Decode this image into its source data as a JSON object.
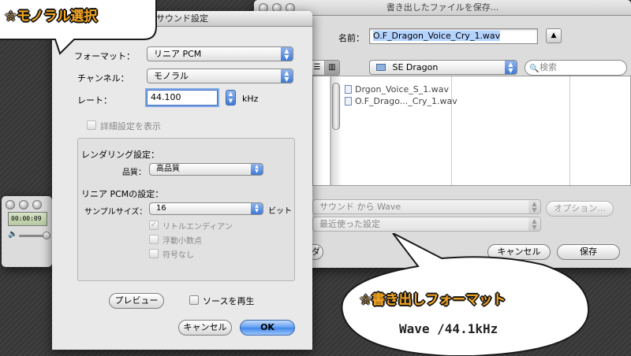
{
  "save_window": {
    "title": "書き出したファイルを保存...",
    "name_label": "名前：",
    "filename": "O.F_Dragon_Voice_Cry_1.wav",
    "folder": "SE Dragon",
    "search_placeholder": "検索",
    "files": [
      "Drgon_Voice_S_1.wav",
      "O.F_Drago..._Cry_1.wav"
    ],
    "export_popup": "サウンド から Wave",
    "options_button": "オプション...",
    "recent_settings": "最近使った設定",
    "new_folder_partial": "ダ",
    "cancel_button": "キャンセル",
    "save_button": "保存"
  },
  "player_window": {
    "time": "00:00:09"
  },
  "sound_dialog": {
    "title": "サウンド設定",
    "format_label": "フォーマット：",
    "format_value": "リニア PCM",
    "channel_label": "チャンネル：",
    "channel_value": "モノラル",
    "rate_label": "レート：",
    "rate_value": "44.100",
    "rate_unit": "kHz",
    "show_advanced": "詳細設定を表示",
    "render_heading": "レンダリング設定：",
    "quality_label": "品質：",
    "quality_value": "高品質",
    "pcm_heading": "リニア PCMの設定：",
    "sample_size_label": "サンプルサイズ：",
    "sample_size_value": "16",
    "bit_unit": "ビット",
    "little_endian": "リトルエンディアン",
    "floating": "浮動小数点",
    "unsigned": "符号なし",
    "preview_button": "プレビュー",
    "play_source": "ソースを再生",
    "cancel_button": "キャンセル",
    "ok_button": "OK"
  },
  "annotations": {
    "mono_callout": "☆モノラル選択",
    "format_callout": "☆書き出しフォーマット",
    "format_detail": "Wave /44.1kHz"
  }
}
